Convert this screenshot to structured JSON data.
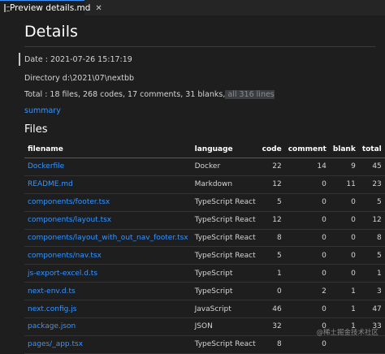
{
  "tab": {
    "title": "Preview details.md",
    "close_glyph": "✕",
    "icon": "preview-icon"
  },
  "page": {
    "title": "Details",
    "date": "Date : 2021-07-26 15:17:19",
    "directory": "Directory d:\\2021\\07\\nextbb",
    "total_main": "Total : 18 files, 268 codes, 17 comments, 31 blanks,",
    "total_highlight": " all 316 lines",
    "summary_link": "summary",
    "files_heading": "Files"
  },
  "table": {
    "headers": [
      "filename",
      "language",
      "code",
      "comment",
      "blank",
      "total"
    ],
    "rows": [
      {
        "filename": "Dockerfile",
        "language": "Docker",
        "code": "22",
        "comment": "14",
        "blank": "9",
        "total": "45"
      },
      {
        "filename": "README.md",
        "language": "Markdown",
        "code": "12",
        "comment": "0",
        "blank": "11",
        "total": "23"
      },
      {
        "filename": "components/footer.tsx",
        "language": "TypeScript React",
        "code": "5",
        "comment": "0",
        "blank": "0",
        "total": "5"
      },
      {
        "filename": "components/layout.tsx",
        "language": "TypeScript React",
        "code": "12",
        "comment": "0",
        "blank": "0",
        "total": "12"
      },
      {
        "filename": "components/layout_with_out_nav_footer.tsx",
        "language": "TypeScript React",
        "code": "8",
        "comment": "0",
        "blank": "0",
        "total": "8"
      },
      {
        "filename": "components/nav.tsx",
        "language": "TypeScript React",
        "code": "5",
        "comment": "0",
        "blank": "0",
        "total": "5"
      },
      {
        "filename": "js-export-excel.d.ts",
        "language": "TypeScript",
        "code": "1",
        "comment": "0",
        "blank": "0",
        "total": "1"
      },
      {
        "filename": "next-env.d.ts",
        "language": "TypeScript",
        "code": "0",
        "comment": "2",
        "blank": "1",
        "total": "3"
      },
      {
        "filename": "next.config.js",
        "language": "JavaScript",
        "code": "46",
        "comment": "0",
        "blank": "1",
        "total": "47"
      },
      {
        "filename": "package.json",
        "language": "JSON",
        "code": "32",
        "comment": "0",
        "blank": "1",
        "total": "33"
      },
      {
        "filename": "pages/_app.tsx",
        "language": "TypeScript React",
        "code": "8",
        "comment": "0",
        "blank": "",
        "total": ""
      }
    ]
  },
  "watermark": "@稀土掘金技术社区",
  "colors": {
    "background": "#1e1e1e",
    "link": "#3794ff",
    "tab_accent": "#3794ff"
  }
}
